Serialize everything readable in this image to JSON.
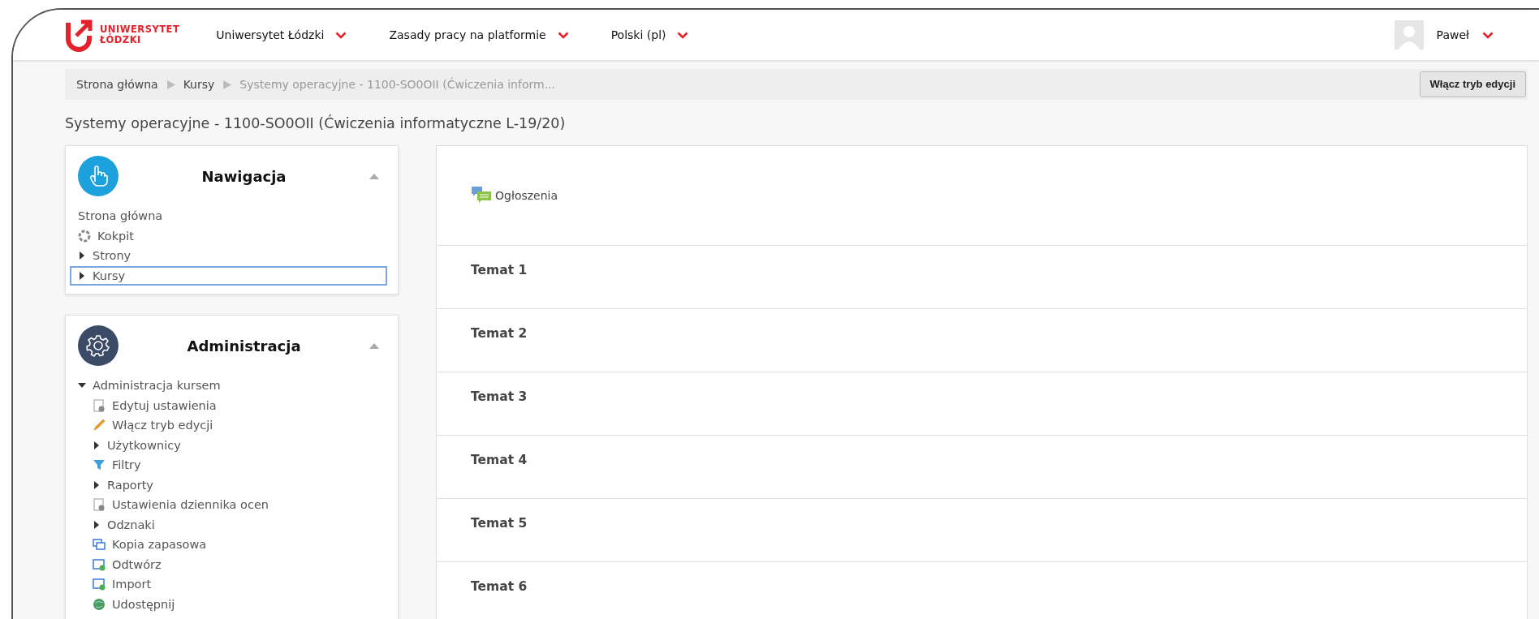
{
  "header": {
    "logo_lines": [
      "UNIWERSYTET",
      "ŁÓDZKI"
    ],
    "menus": [
      {
        "label": "Uniwersytet Łódzki"
      },
      {
        "label": "Zasady pracy na platformie"
      },
      {
        "label": "Polski (pl)"
      }
    ],
    "user": {
      "name": "Paweł"
    }
  },
  "breadcrumb": {
    "items": [
      "Strona główna",
      "Kursy",
      "Systemy operacyjne - 1100-SO0OII (Ćwiczenia inform..."
    ],
    "button": "Włącz tryb edycji"
  },
  "page_title": "Systemy operacyjne - 1100-SO0OII (Ćwiczenia informatyczne L-19/20)",
  "blocks": [
    {
      "kind": "navigation",
      "title": "Nawigacja",
      "items": [
        {
          "label": "Strona główna",
          "kind": "plain",
          "selected": false
        },
        {
          "label": "Kokpit",
          "kind": "icon",
          "selected": false
        },
        {
          "label": "Strony",
          "kind": "branch",
          "expanded": false,
          "selected": false
        },
        {
          "label": "Kursy",
          "kind": "branch",
          "expanded": false,
          "selected": true
        }
      ]
    },
    {
      "kind": "administration",
      "title": "Administracja",
      "items": [
        {
          "label": "Administracja kursem",
          "kind": "branch",
          "expanded": true,
          "selected": false,
          "children": [
            {
              "label": "Edytuj ustawienia",
              "kind": "icon",
              "selected": false
            },
            {
              "label": "Włącz tryb edycji",
              "kind": "icon",
              "selected": false
            },
            {
              "label": "Użytkownicy",
              "kind": "branch",
              "expanded": false,
              "selected": false
            },
            {
              "label": "Filtry",
              "kind": "icon",
              "selected": false
            },
            {
              "label": "Raporty",
              "kind": "branch",
              "expanded": false,
              "selected": false
            },
            {
              "label": "Ustawienia dziennika ocen",
              "kind": "icon",
              "selected": false
            },
            {
              "label": "Odznaki",
              "kind": "branch",
              "expanded": false,
              "selected": false
            },
            {
              "label": "Kopia zapasowa",
              "kind": "icon",
              "selected": false
            },
            {
              "label": "Odtwórz",
              "kind": "icon",
              "selected": false
            },
            {
              "label": "Import",
              "kind": "icon",
              "selected": false
            },
            {
              "label": "Udostępnij",
              "kind": "icon",
              "selected": false
            }
          ]
        }
      ]
    }
  ],
  "sections": [
    {
      "kind": "activities",
      "activities": [
        {
          "label": "Ogłoszenia"
        }
      ]
    },
    {
      "kind": "topic",
      "title": "Temat 1"
    },
    {
      "kind": "topic",
      "title": "Temat 2"
    },
    {
      "kind": "topic",
      "title": "Temat 3"
    },
    {
      "kind": "topic",
      "title": "Temat 4"
    },
    {
      "kind": "topic",
      "title": "Temat 5"
    },
    {
      "kind": "topic",
      "title": "Temat 6"
    }
  ]
}
